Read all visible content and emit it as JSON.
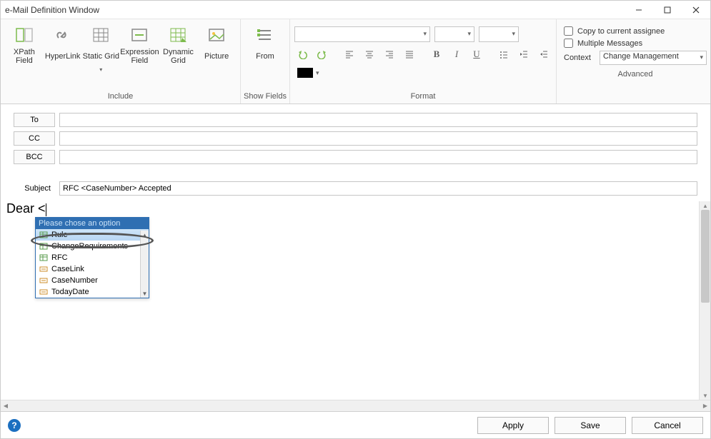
{
  "window": {
    "title": "e-Mail Definition Window"
  },
  "ribbon": {
    "include": {
      "label": "Include",
      "xpath": "XPath\nField",
      "hyperlink": "HyperLink",
      "staticgrid": "Static\nGrid",
      "exprfield": "Expression\nField",
      "dyngrid": "Dynamic\nGrid",
      "picture": "Picture"
    },
    "showfields": {
      "label": "Show Fields",
      "from": "From"
    },
    "format": {
      "label": "Format"
    },
    "advanced": {
      "label": "Advanced",
      "copy": "Copy to current assignee",
      "multi": "Multiple Messages",
      "context_label": "Context",
      "context_value": "Change Management"
    }
  },
  "fields": {
    "to": "To",
    "cc": "CC",
    "bcc": "BCC",
    "subject_label": "Subject",
    "subject_value": "RFC <CaseNumber> Accepted",
    "to_value": "",
    "cc_value": "",
    "bcc_value": ""
  },
  "body": {
    "text": "Dear <"
  },
  "autocomplete": {
    "header": "Please chose an option",
    "items": [
      {
        "label": "Rule",
        "selected": true,
        "kind": "rule"
      },
      {
        "label": "ChangeRequirements",
        "selected": false,
        "kind": "obj"
      },
      {
        "label": "RFC",
        "selected": false,
        "kind": "obj"
      },
      {
        "label": "CaseLink",
        "selected": false,
        "kind": "attr"
      },
      {
        "label": "CaseNumber",
        "selected": false,
        "kind": "attr"
      },
      {
        "label": "TodayDate",
        "selected": false,
        "kind": "attr"
      }
    ]
  },
  "footer": {
    "apply": "Apply",
    "save": "Save",
    "cancel": "Cancel"
  }
}
